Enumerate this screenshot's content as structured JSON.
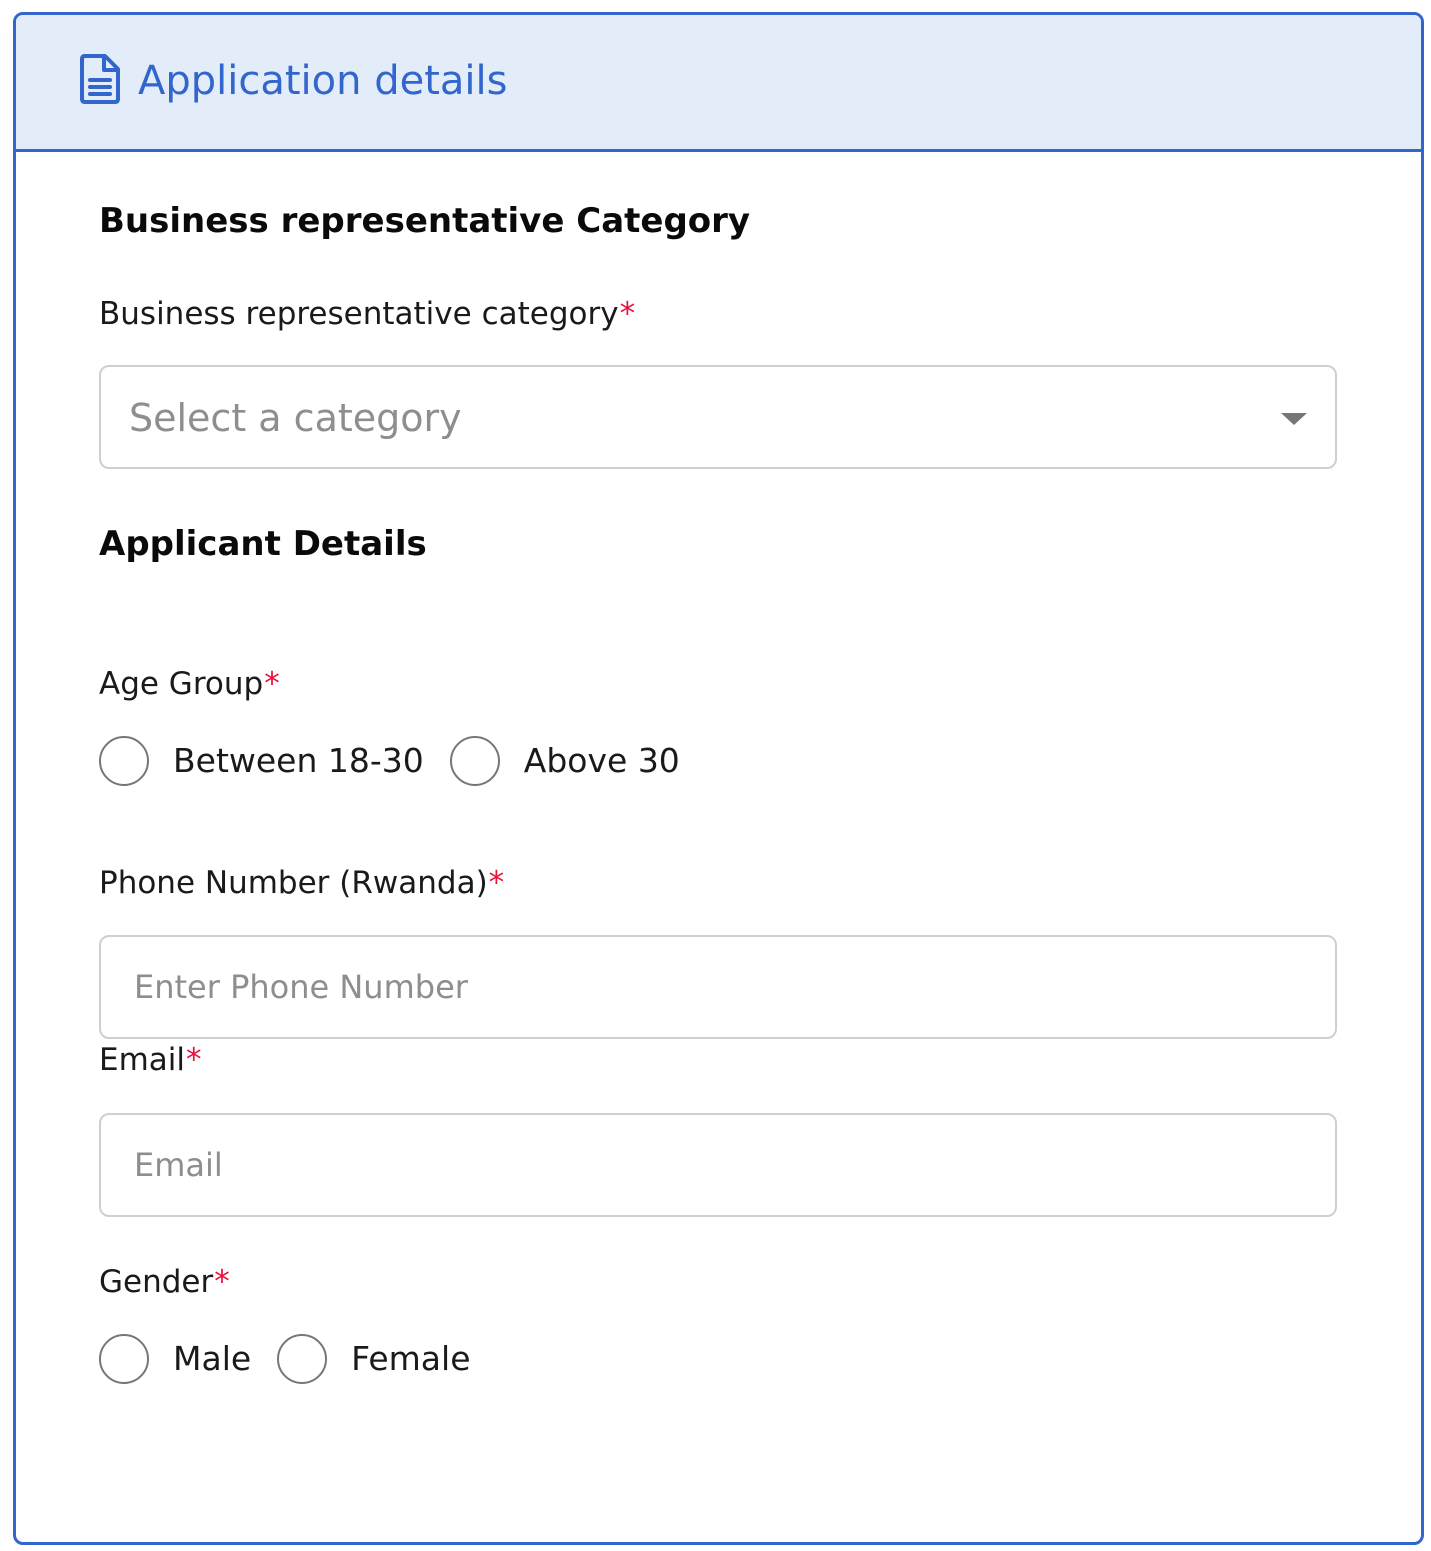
{
  "header": {
    "icon": "document-icon",
    "title": "Application details",
    "accent_color": "#3366cc",
    "background_color": "#e2edf9"
  },
  "business_section": {
    "title": "Business representative Category",
    "category_field": {
      "label": "Business representative category",
      "required_mark": "*",
      "placeholder": "Select a category"
    }
  },
  "applicant_section": {
    "title": "Applicant Details",
    "age_group": {
      "label": "Age Group",
      "required_mark": "*",
      "options": [
        "Between 18-30",
        "Above 30"
      ]
    },
    "phone": {
      "label": "Phone Number (Rwanda)",
      "required_mark": "*",
      "placeholder": "Enter Phone Number",
      "value": ""
    },
    "email": {
      "label": "Email",
      "required_mark": "*",
      "placeholder": "Email",
      "value": ""
    },
    "gender": {
      "label": "Gender",
      "required_mark": "*",
      "options": [
        "Male",
        "Female"
      ]
    }
  },
  "required_color": "#e8113a"
}
